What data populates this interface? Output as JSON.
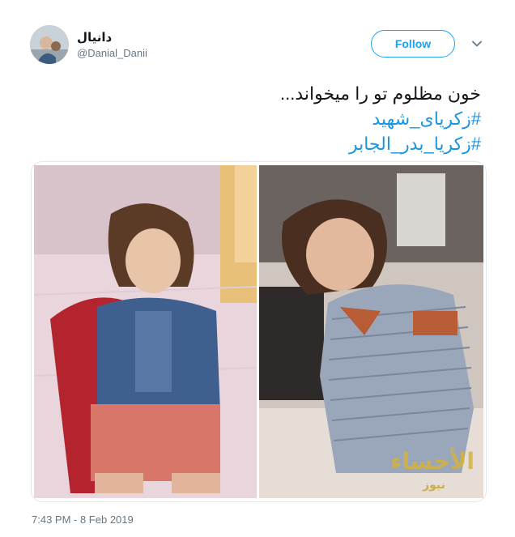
{
  "user": {
    "display_name": "دانیال",
    "handle": "@Danial_Danii"
  },
  "follow_button": {
    "label": "Follow"
  },
  "tweet": {
    "lines": [
      "خون مظلوم تو را میخواند...",
      "#زکریای_شهید",
      "#زکریا_بدر_الجابر"
    ]
  },
  "media": {
    "watermark_text": "الأحساء",
    "watermark_sub": "نيوز"
  },
  "timestamp": "7:43 PM - 8 Feb 2019",
  "colors": {
    "accent": "#1da1f2",
    "hashtag": "#1b95e0",
    "secondary_text": "#657786"
  },
  "icons": [
    "avatar-image",
    "chevron-down-icon"
  ]
}
